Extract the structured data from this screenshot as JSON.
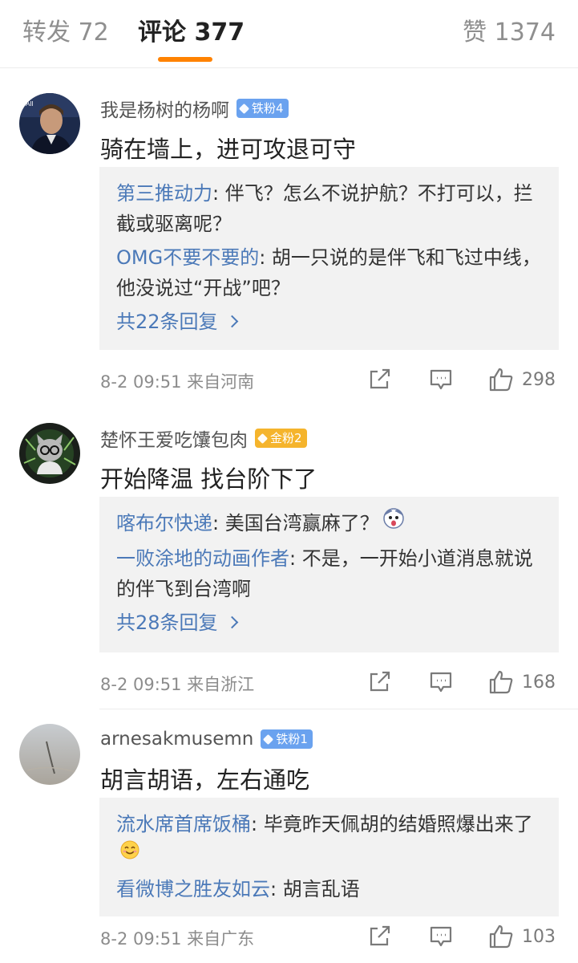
{
  "tabs": {
    "repost": "转发 72",
    "comment": "评论 377",
    "like": "赞 1374"
  },
  "comments": [
    {
      "username": "我是杨树的杨啊",
      "badge": "铁粉4",
      "badge_color": "#6aa2ef",
      "text": "骑在墙上，进可攻退可守",
      "replies": [
        {
          "user": "第三推动力",
          "text": ": 伴飞？怎么不说护航？不打可以，拦截或驱离呢？"
        },
        {
          "user": "OMG不要不要的",
          "text": ": 胡一只说的是伴飞和飞过中线，他没说过“开战”吧？"
        }
      ],
      "reply_count": "共22条回复",
      "time_location": "8-2 09:51  来自河南",
      "likes": "298"
    },
    {
      "username": "楚怀王爱吃馕包肉",
      "badge": "金粉2",
      "badge_color": "#f5b42c",
      "text": "开始降温 找台阶下了",
      "replies": [
        {
          "user": "喀布尔快递",
          "text": ": 美国台湾赢麻了？"
        },
        {
          "user": "一败涂地的动画作者",
          "text": ": 不是，一开始小道消息就说的伴飞到台湾啊"
        }
      ],
      "reply_count": "共28条回复",
      "time_location": "8-2 09:51  来自浙江",
      "likes": "168"
    },
    {
      "username": "arnesakmusemn",
      "badge": "铁粉1",
      "badge_color": "#6aa2ef",
      "text": "胡言胡语，左右通吃",
      "replies": [
        {
          "user": "流水席首席饭桶",
          "text": ": 毕竟昨天佩胡的结婚照爆出来了"
        },
        {
          "user": "看微博之胜友如云",
          "text": ": 胡言乱语"
        }
      ],
      "time_location": "8-2 09:51  来自广东",
      "likes": "103"
    }
  ],
  "icons": {
    "share": "share-icon",
    "reply": "comment-icon",
    "like": "thumbs-up-icon",
    "badge": "diamond-icon",
    "chevron": "chevron-right-icon"
  },
  "colors": {
    "accent": "#ff8200",
    "link": "#4b79b8",
    "reply_bg": "#f2f2f2"
  }
}
